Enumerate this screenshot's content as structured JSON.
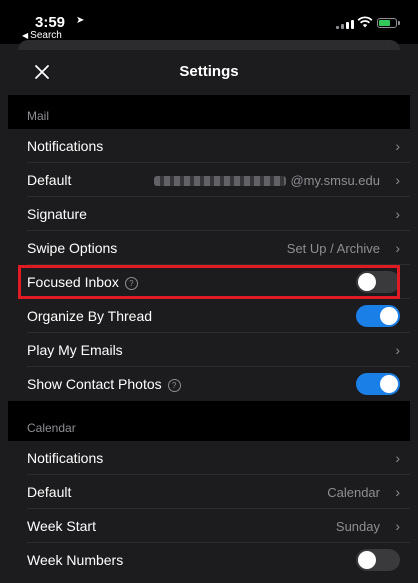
{
  "status_bar": {
    "time": "3:59",
    "back_label": "Search",
    "location_icon": "location-arrow-icon",
    "signal_icon": "cellular-signal-icon",
    "wifi_icon": "wifi-icon",
    "battery_icon": "battery-charging-icon",
    "battery_color": "#34c759"
  },
  "nav": {
    "title": "Settings",
    "close_icon": "close-icon"
  },
  "mail": {
    "header": "Mail",
    "notifications_label": "Notifications",
    "default_label": "Default",
    "default_value_domain": "@my.smsu.edu",
    "signature_label": "Signature",
    "swipe_label": "Swipe Options",
    "swipe_value": "Set Up / Archive",
    "focused_label": "Focused Inbox",
    "focused_on": false,
    "organize_label": "Organize By Thread",
    "organize_on": true,
    "play_label": "Play My Emails",
    "contact_photos_label": "Show Contact Photos",
    "contact_photos_on": true
  },
  "calendar": {
    "header": "Calendar",
    "notifications_label": "Notifications",
    "default_label": "Default",
    "default_value": "Calendar",
    "week_start_label": "Week Start",
    "week_start_value": "Sunday",
    "week_numbers_label": "Week Numbers",
    "week_numbers_on": false
  },
  "glyphs": {
    "chevron": "›",
    "help": "?"
  },
  "colors": {
    "accent": "#1a7fe6",
    "highlight": "#e01b24",
    "background": "#000000",
    "cell": "#1c1c1e"
  }
}
